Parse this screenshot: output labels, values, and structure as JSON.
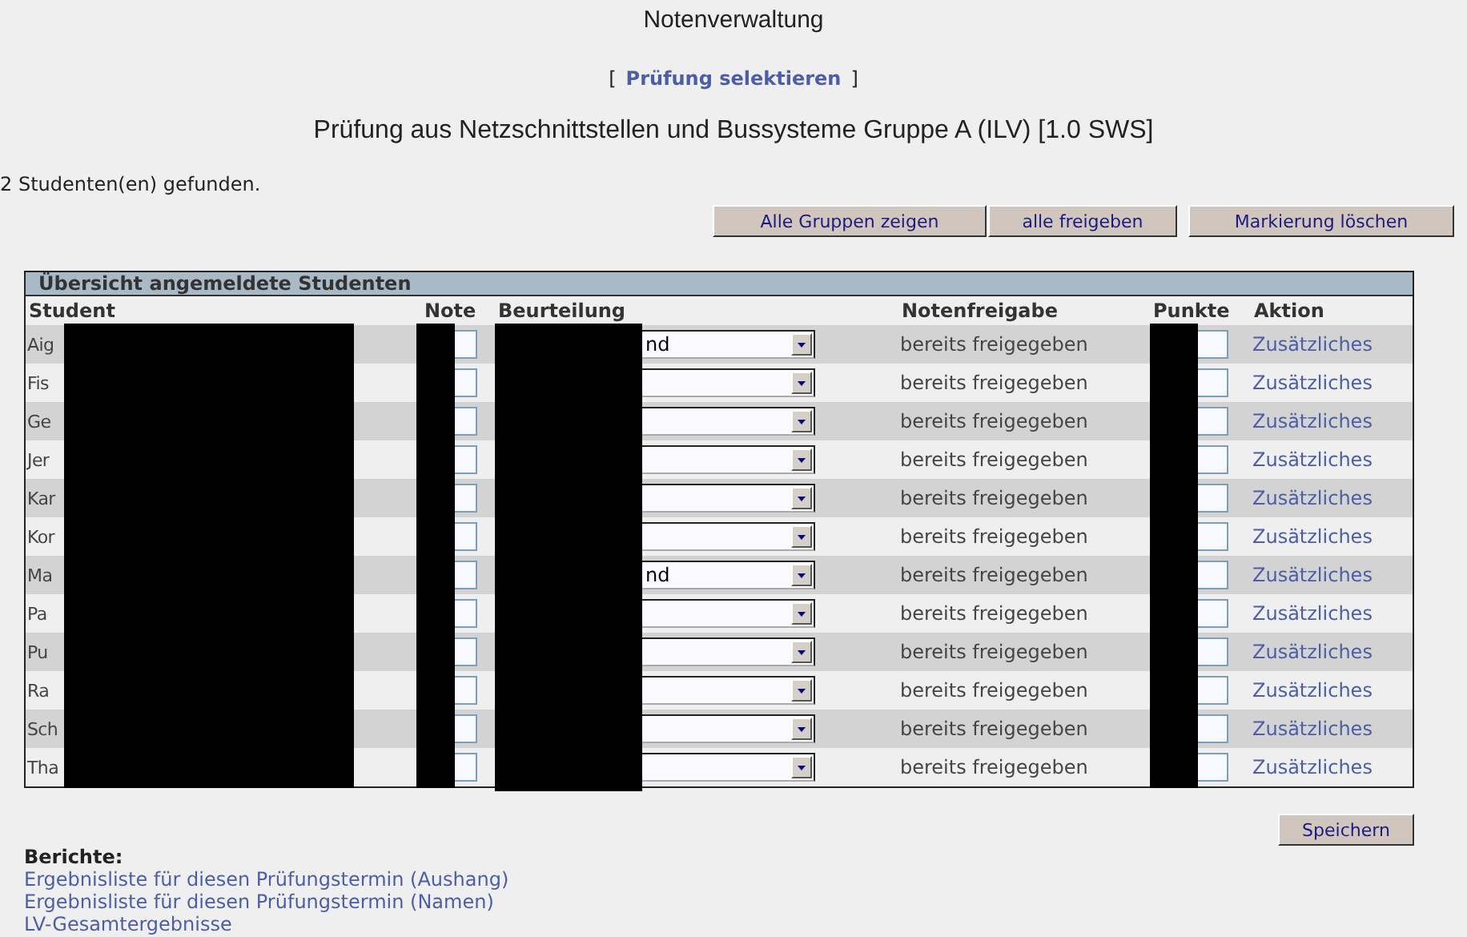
{
  "title": "Notenverwaltung",
  "select_link": {
    "open": "[",
    "label": "Prüfung selektieren",
    "close": "]"
  },
  "exam_heading": "Prüfung aus Netzschnittstellen und Bussysteme Gruppe A (ILV) [1.0 SWS]",
  "result_count": "2 Studenten(en) gefunden.",
  "toolbar_buttons": [
    "Alle Gruppen zeigen",
    "alle freigeben",
    "Markierung löschen"
  ],
  "table": {
    "caption": "Übersicht angemeldete Studenten",
    "columns": [
      "Student",
      "Note",
      "Beurteilung",
      "Notenfreigabe",
      "Punkte",
      "Aktion"
    ],
    "rows": [
      {
        "student": "Aig",
        "beurteilung": "nd",
        "freigabe": "bereits freigegeben",
        "aktion": "Zusätzliches"
      },
      {
        "student": "Fis",
        "freigabe": "bereits freigegeben",
        "aktion": "Zusätzliches"
      },
      {
        "student": "Ge",
        "freigabe": "bereits freigegeben",
        "aktion": "Zusätzliches"
      },
      {
        "student": "Jer",
        "freigabe": "bereits freigegeben",
        "aktion": "Zusätzliches"
      },
      {
        "student": "Kar",
        "freigabe": "bereits freigegeben",
        "aktion": "Zusätzliches"
      },
      {
        "student": "Kor",
        "freigabe": "bereits freigegeben",
        "aktion": "Zusätzliches"
      },
      {
        "student": "Ma",
        "beurteilung": "nd",
        "freigabe": "bereits freigegeben",
        "aktion": "Zusätzliches"
      },
      {
        "student": "Pa",
        "freigabe": "bereits freigegeben",
        "aktion": "Zusätzliches"
      },
      {
        "student": "Pu",
        "freigabe": "bereits freigegeben",
        "aktion": "Zusätzliches"
      },
      {
        "student": "Ra",
        "freigabe": "bereits freigegeben",
        "aktion": "Zusätzliches"
      },
      {
        "student": "Sch",
        "freigabe": "bereits freigegeben",
        "aktion": "Zusätzliches"
      },
      {
        "student": "Tha",
        "freigabe": "bereits freigegeben",
        "aktion": "Zusätzliches"
      }
    ]
  },
  "save_button": "Speichern",
  "reports": {
    "heading": "Berichte:",
    "links": [
      "Ergebnisliste für diesen Prüfungstermin (Aushang)",
      "Ergebnisliste für diesen Prüfungstermin (Namen)",
      "LV-Gesamtergebnisse"
    ]
  }
}
